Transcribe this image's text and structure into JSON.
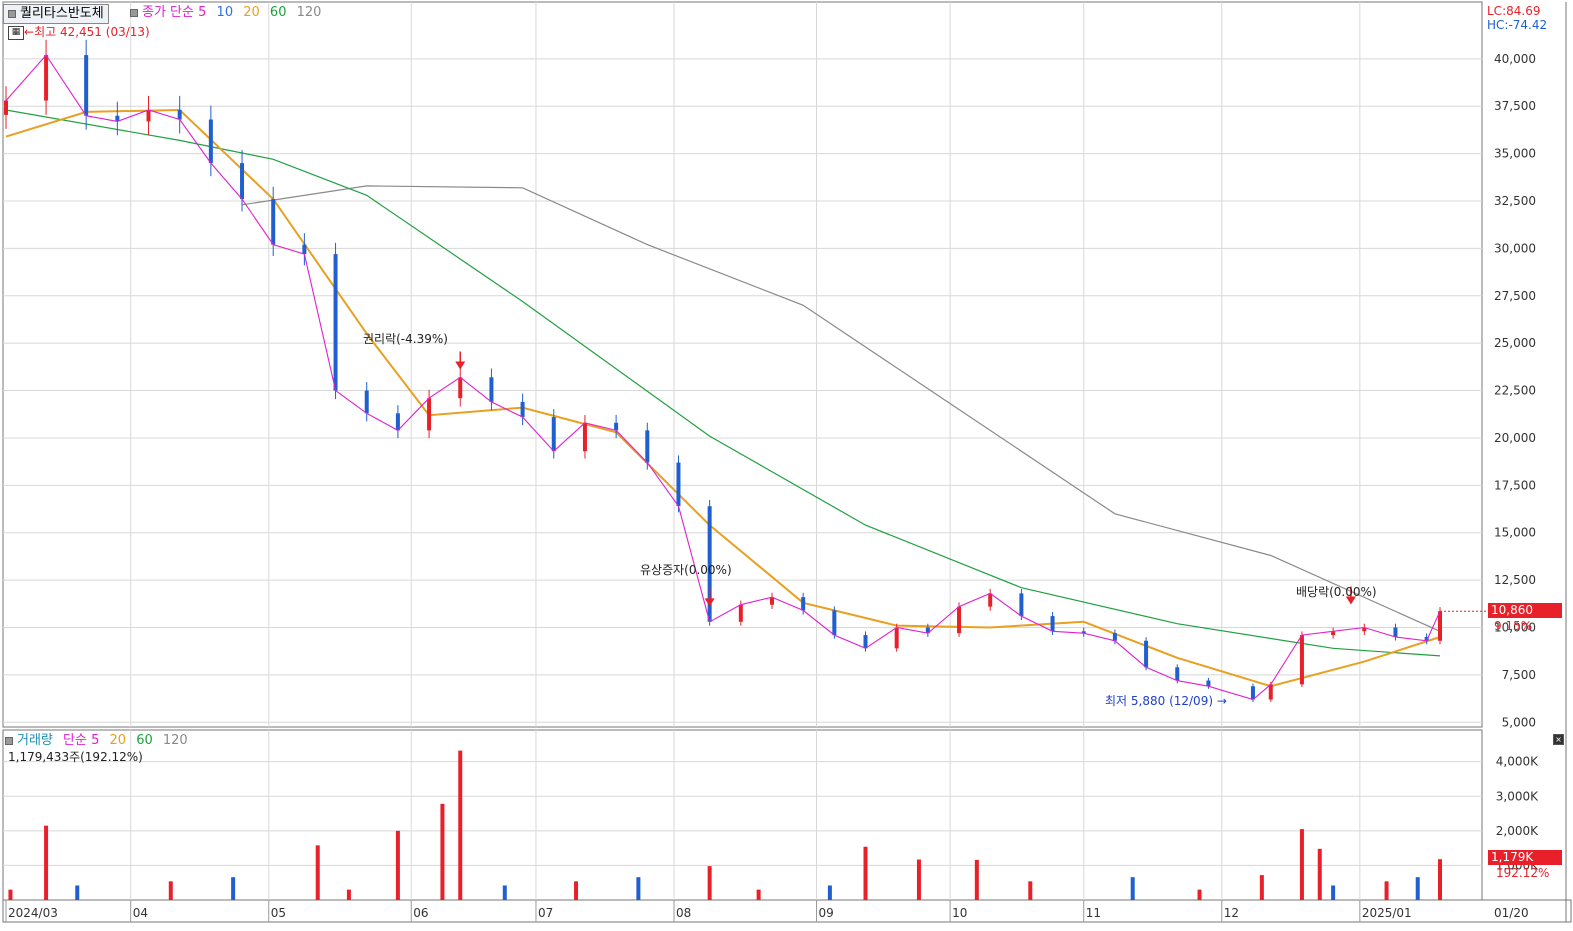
{
  "window": {
    "stock_name": "퀄리타스반도체",
    "ma_legend": {
      "prefix": "종가 단순",
      "periods": [
        "5",
        "10",
        "20",
        "60",
        "120"
      ]
    },
    "volume_legend": {
      "prefix": "거래량",
      "method": "단순",
      "periods": [
        "5",
        "20",
        "60",
        "120"
      ]
    },
    "volume_info": "1,179,433주(192.12%)",
    "lc_label": "LC:84.69",
    "hc_label": "HC:-74.42",
    "high_marker": "최고 42,451 (03/13)",
    "low_marker": "최저 5,880 (12/09)",
    "price_tag": "10,860",
    "change_pct": "9.15%",
    "vol_tag": "1,179K",
    "vol_pct": "192.12%",
    "events": {
      "rights": "권리락(-4.39%)",
      "paid_in": "유상증자(0.00%)",
      "dividend": "배당락(0.00%)"
    },
    "colors": {
      "up": "#e8202a",
      "down": "#1f5fd0",
      "ma5": "#e020d0",
      "ma10": "#2f6fe8",
      "ma20": "#e8a020",
      "ma60": "#20a040",
      "ma120": "#8a8a8a"
    }
  },
  "chart_data": [
    {
      "type": "candlestick",
      "title": "퀄리타스반도체",
      "y_ticks": [
        "40,000",
        "37,500",
        "35,000",
        "32,500",
        "30,000",
        "27,500",
        "25,000",
        "22,500",
        "20,000",
        "17,500",
        "15,000",
        "12,500",
        "10,000",
        "7,500",
        "5,000"
      ],
      "ylim": [
        4750,
        43000
      ],
      "x_ticks": [
        "2024/03",
        "04",
        "05",
        "06",
        "07",
        "08",
        "09",
        "10",
        "11",
        "12",
        "2025/01",
        "01/20"
      ],
      "grid": true,
      "close_series": [
        {
          "date": "2024-03-04",
          "close": 37800
        },
        {
          "date": "2024-03-13",
          "close": 40200
        },
        {
          "date": "2024-03-22",
          "close": 37000
        },
        {
          "date": "2024-03-29",
          "close": 36700
        },
        {
          "date": "2024-04-05",
          "close": 37300
        },
        {
          "date": "2024-04-12",
          "close": 36800
        },
        {
          "date": "2024-04-19",
          "close": 34500
        },
        {
          "date": "2024-04-26",
          "close": 32600
        },
        {
          "date": "2024-05-03",
          "close": 30200
        },
        {
          "date": "2024-05-10",
          "close": 29700
        },
        {
          "date": "2024-05-17",
          "close": 22500
        },
        {
          "date": "2024-05-24",
          "close": 21300
        },
        {
          "date": "2024-05-31",
          "close": 20400
        },
        {
          "date": "2024-06-07",
          "close": 22100
        },
        {
          "date": "2024-06-14",
          "close": 23200
        },
        {
          "date": "2024-06-21",
          "close": 21900
        },
        {
          "date": "2024-06-28",
          "close": 21100
        },
        {
          "date": "2024-07-05",
          "close": 19300
        },
        {
          "date": "2024-07-12",
          "close": 20800
        },
        {
          "date": "2024-07-19",
          "close": 20400
        },
        {
          "date": "2024-07-26",
          "close": 18700
        },
        {
          "date": "2024-08-02",
          "close": 16400
        },
        {
          "date": "2024-08-09",
          "close": 10300
        },
        {
          "date": "2024-08-16",
          "close": 11200
        },
        {
          "date": "2024-08-23",
          "close": 11600
        },
        {
          "date": "2024-08-30",
          "close": 10900
        },
        {
          "date": "2024-09-06",
          "close": 9600
        },
        {
          "date": "2024-09-13",
          "close": 8900
        },
        {
          "date": "2024-09-20",
          "close": 10000
        },
        {
          "date": "2024-09-27",
          "close": 9700
        },
        {
          "date": "2024-10-04",
          "close": 11100
        },
        {
          "date": "2024-10-11",
          "close": 11800
        },
        {
          "date": "2024-10-18",
          "close": 10600
        },
        {
          "date": "2024-10-25",
          "close": 9800
        },
        {
          "date": "2024-11-01",
          "close": 9700
        },
        {
          "date": "2024-11-08",
          "close": 9300
        },
        {
          "date": "2024-11-15",
          "close": 7900
        },
        {
          "date": "2024-11-22",
          "close": 7200
        },
        {
          "date": "2024-11-29",
          "close": 6900
        },
        {
          "date": "2024-12-09",
          "close": 6200
        },
        {
          "date": "2024-12-13",
          "close": 7000
        },
        {
          "date": "2024-12-20",
          "close": 9600
        },
        {
          "date": "2024-12-27",
          "close": 9800
        },
        {
          "date": "2025-01-03",
          "close": 10000
        },
        {
          "date": "2025-01-10",
          "close": 9500
        },
        {
          "date": "2025-01-17",
          "close": 9300
        },
        {
          "date": "2025-01-20",
          "close": 10860
        }
      ],
      "ma20": [
        {
          "date": "2024-03-04",
          "value": 35900
        },
        {
          "date": "2024-03-22",
          "value": 37200
        },
        {
          "date": "2024-04-12",
          "value": 37300
        },
        {
          "date": "2024-05-03",
          "value": 32600
        },
        {
          "date": "2024-05-24",
          "value": 25500
        },
        {
          "date": "2024-06-07",
          "value": 21200
        },
        {
          "date": "2024-06-28",
          "value": 21600
        },
        {
          "date": "2024-07-19",
          "value": 20300
        },
        {
          "date": "2024-08-09",
          "value": 15400
        },
        {
          "date": "2024-08-30",
          "value": 11300
        },
        {
          "date": "2024-09-20",
          "value": 10100
        },
        {
          "date": "2024-10-11",
          "value": 10000
        },
        {
          "date": "2024-11-01",
          "value": 10300
        },
        {
          "date": "2024-11-22",
          "value": 8400
        },
        {
          "date": "2024-12-13",
          "value": 6900
        },
        {
          "date": "2025-01-03",
          "value": 8200
        },
        {
          "date": "2025-01-20",
          "value": 9500
        }
      ],
      "ma60": [
        {
          "date": "2024-03-04",
          "value": 37300
        },
        {
          "date": "2024-04-12",
          "value": 35700
        },
        {
          "date": "2024-05-03",
          "value": 34700
        },
        {
          "date": "2024-05-24",
          "value": 32800
        },
        {
          "date": "2024-06-28",
          "value": 27200
        },
        {
          "date": "2024-08-09",
          "value": 20100
        },
        {
          "date": "2024-09-13",
          "value": 15400
        },
        {
          "date": "2024-10-18",
          "value": 12100
        },
        {
          "date": "2024-11-22",
          "value": 10200
        },
        {
          "date": "2024-12-27",
          "value": 8900
        },
        {
          "date": "2025-01-20",
          "value": 8500
        }
      ],
      "ma120": [
        {
          "date": "2024-04-26",
          "value": 32300
        },
        {
          "date": "2024-05-24",
          "value": 33300
        },
        {
          "date": "2024-06-28",
          "value": 33200
        },
        {
          "date": "2024-07-26",
          "value": 30200
        },
        {
          "date": "2024-08-30",
          "value": 27000
        },
        {
          "date": "2024-10-04",
          "value": 21500
        },
        {
          "date": "2024-11-08",
          "value": 16000
        },
        {
          "date": "2024-12-13",
          "value": 13800
        },
        {
          "date": "2025-01-20",
          "value": 9800
        }
      ]
    },
    {
      "type": "bar",
      "title": "거래량",
      "y_ticks": [
        "4,000K",
        "3,000K",
        "2,000K",
        "1,000K"
      ],
      "ylim": [
        0,
        4800
      ],
      "unit": "K",
      "volume_spikes_k": [
        {
          "date": "2024-03-13",
          "value": 2150
        },
        {
          "date": "2024-05-13",
          "value": 1580
        },
        {
          "date": "2024-05-31",
          "value": 2000
        },
        {
          "date": "2024-06-10",
          "value": 2780
        },
        {
          "date": "2024-06-14",
          "value": 4320
        },
        {
          "date": "2024-08-09",
          "value": 980
        },
        {
          "date": "2024-09-13",
          "value": 1540
        },
        {
          "date": "2024-09-25",
          "value": 1170
        },
        {
          "date": "2024-10-08",
          "value": 1160
        },
        {
          "date": "2024-12-11",
          "value": 720
        },
        {
          "date": "2024-12-20",
          "value": 2050
        },
        {
          "date": "2024-12-24",
          "value": 1480
        },
        {
          "date": "2025-01-20",
          "value": 1179
        }
      ]
    }
  ]
}
